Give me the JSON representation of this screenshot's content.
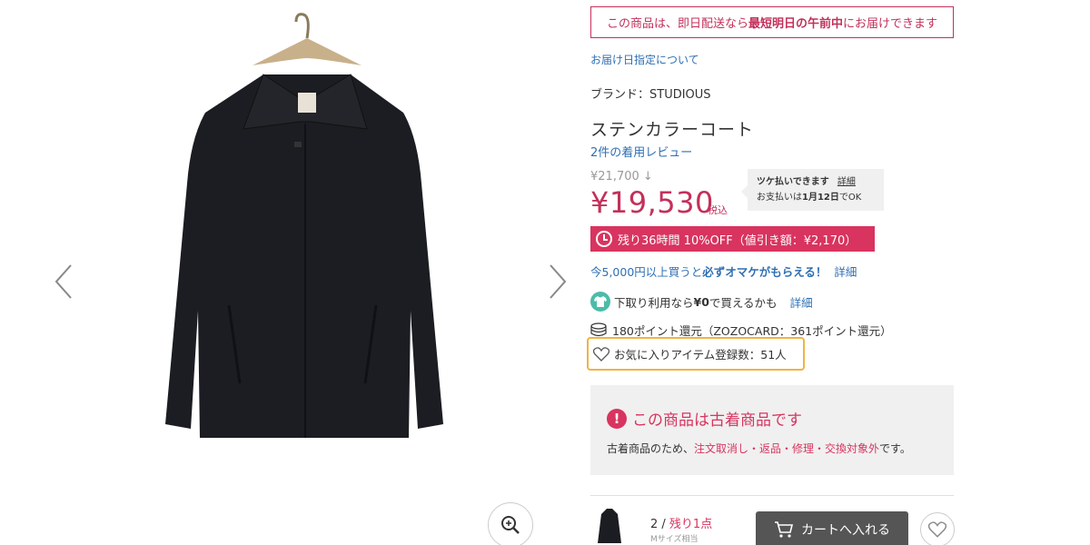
{
  "delivery": {
    "prefix": "この商品は、即日配送なら",
    "emphasis": "最短明日の午前中",
    "suffix": "にお届けできます"
  },
  "delivery_date_link": "お届け日指定について",
  "brand_line": "ブランド：STUDIOUS",
  "product_title": "ステンカラーコート",
  "reviews_link": "2件の着用レビュー",
  "price": {
    "original": "¥21,700 ↓",
    "current": "¥19,530",
    "tax_label": "税込"
  },
  "tsuke": {
    "title": "ツケ払いできます",
    "detail": "詳細",
    "line2_prefix": "お支払いは",
    "line2_date": "1月12日",
    "line2_suffix": "でOK"
  },
  "sale": {
    "text": "残り36時間  10%OFF（値引き額：¥2,170）"
  },
  "omake": {
    "prefix": "今5,000円以上買うと",
    "emphasis": "必ずオマケがもらえる！",
    "detail": "詳細"
  },
  "shitadori": {
    "prefix": "下取り利用なら",
    "emphasis": "¥0",
    "suffix": "で買えるかも",
    "detail": "詳細"
  },
  "points": "180ポイント還元（ZOZOCARD：361ポイント還元）",
  "favorites": "お気に入りアイテム登録数：51人",
  "used_notice": {
    "title": "この商品は古着商品です",
    "desc_prefix": "古着商品のため、",
    "desc_emphasis": "注文取消し・返品・修理・交換対象外",
    "desc_suffix": "です。"
  },
  "stock": {
    "count": "2 / ",
    "remaining": "残り1点",
    "size": "Mサイズ相当"
  },
  "cart_button": "カートへ入れる",
  "colors": {
    "accent": "#d8345f",
    "link": "#2f6fb3",
    "highlight": "#f2b340"
  }
}
